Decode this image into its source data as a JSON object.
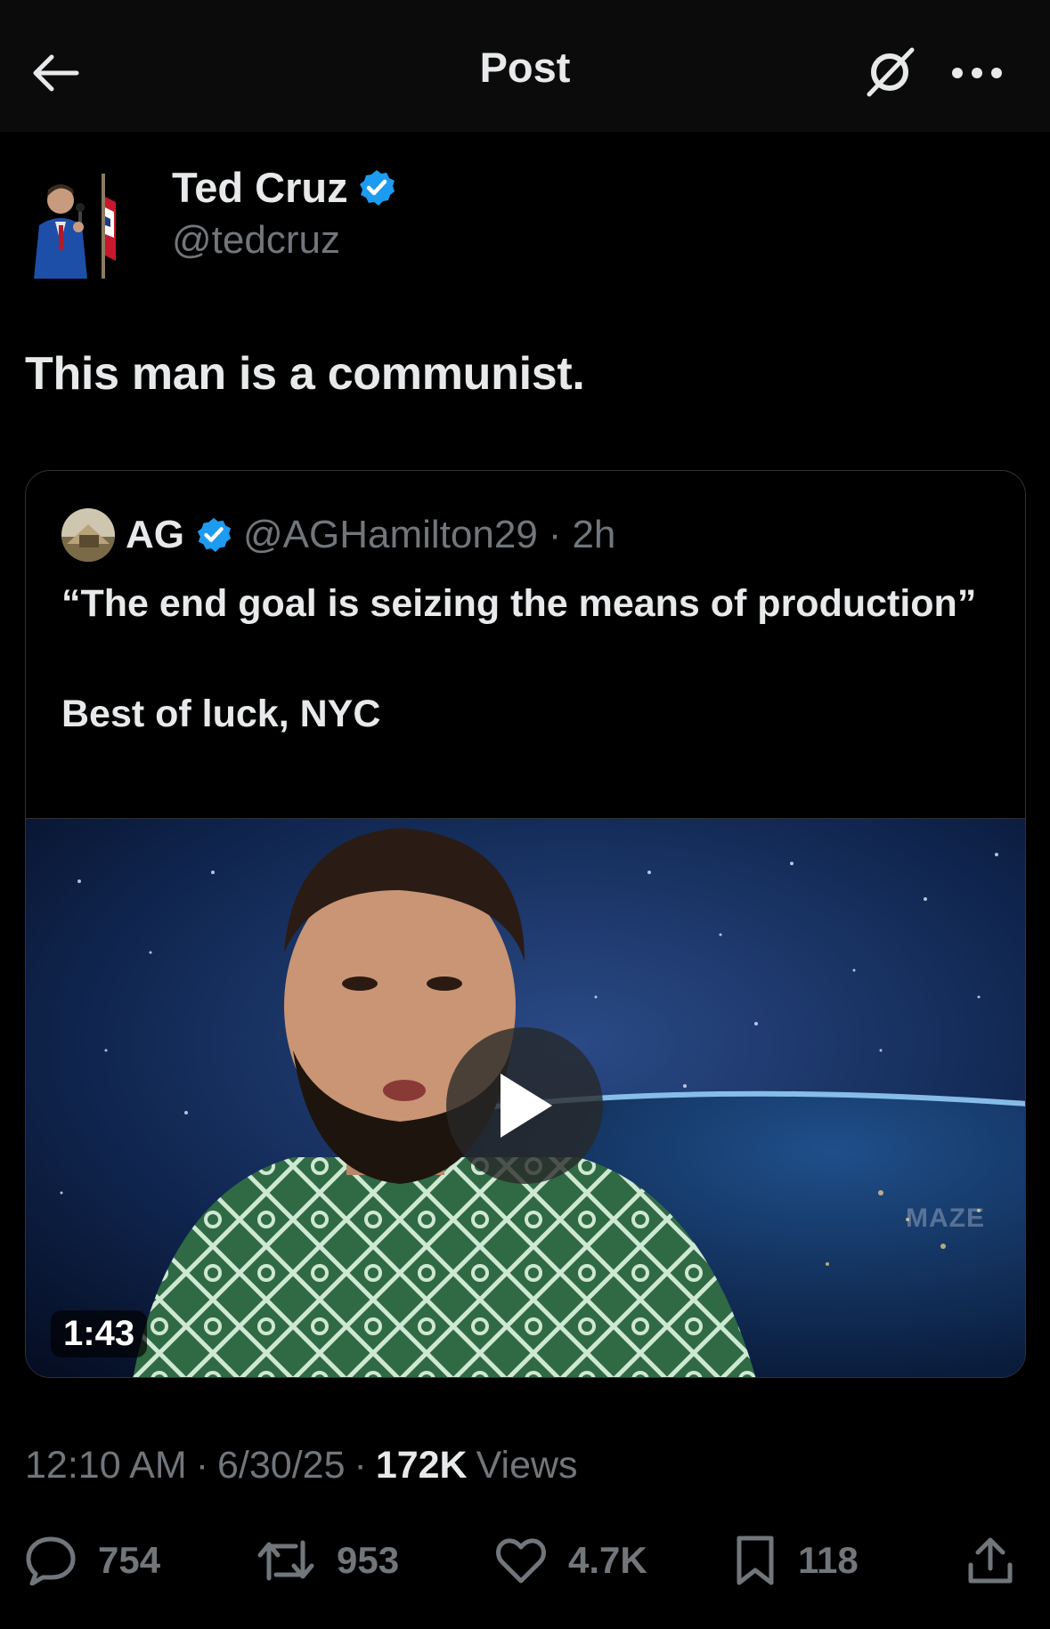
{
  "header": {
    "title": "Post"
  },
  "author": {
    "name": "Ted Cruz",
    "handle": "@tedcruz",
    "verified": true
  },
  "tweet": {
    "text": "This man is a communist."
  },
  "quote": {
    "name": "AG",
    "handle": "@AGHamilton29",
    "separator": "·",
    "time": "2h",
    "text": "“The end goal is seizing the means of production”\n\nBest of luck, NYC",
    "video": {
      "duration": "1:43",
      "watermark": "MAZE"
    }
  },
  "meta": {
    "time": "12:10 AM",
    "date": "6/30/25",
    "views_count": "172K",
    "views_label": "Views",
    "sep": "·"
  },
  "actions": {
    "replies": "754",
    "reposts": "953",
    "likes": "4.7K",
    "bookmarks": "118"
  },
  "colors": {
    "background": "#000000",
    "text": "#e7e9ea",
    "muted": "#71767b",
    "verified": "#1d9bf0",
    "border": "#2f3336"
  },
  "icons": [
    "back-arrow-icon",
    "grok-icon",
    "more-icon",
    "verified-badge-icon",
    "reply-icon",
    "repost-icon",
    "like-icon",
    "bookmark-icon",
    "share-icon",
    "play-icon"
  ]
}
